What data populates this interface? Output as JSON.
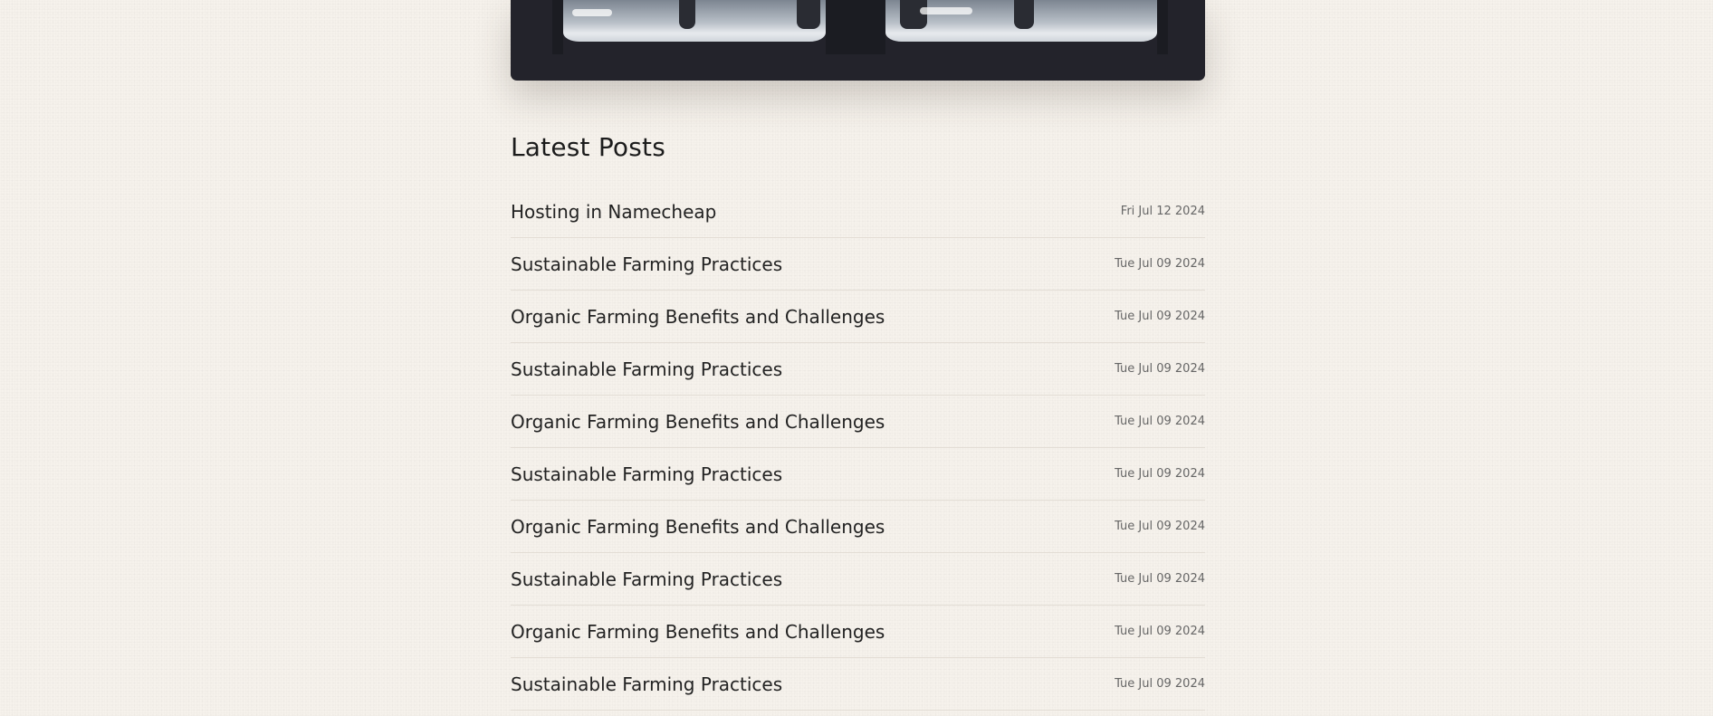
{
  "section": {
    "title": "Latest Posts"
  },
  "posts": [
    {
      "title": "Hosting in Namecheap",
      "date": "Fri Jul 12 2024"
    },
    {
      "title": "Sustainable Farming Practices",
      "date": "Tue Jul 09 2024"
    },
    {
      "title": "Organic Farming Benefits and Challenges",
      "date": "Tue Jul 09 2024"
    },
    {
      "title": "Sustainable Farming Practices",
      "date": "Tue Jul 09 2024"
    },
    {
      "title": "Organic Farming Benefits and Challenges",
      "date": "Tue Jul 09 2024"
    },
    {
      "title": "Sustainable Farming Practices",
      "date": "Tue Jul 09 2024"
    },
    {
      "title": "Organic Farming Benefits and Challenges",
      "date": "Tue Jul 09 2024"
    },
    {
      "title": "Sustainable Farming Practices",
      "date": "Tue Jul 09 2024"
    },
    {
      "title": "Organic Farming Benefits and Challenges",
      "date": "Tue Jul 09 2024"
    },
    {
      "title": "Sustainable Farming Practices",
      "date": "Tue Jul 09 2024"
    }
  ],
  "colors": {
    "background": "#f6f2ec",
    "hero_background": "#23232b",
    "divider": "#e3ddd5"
  }
}
